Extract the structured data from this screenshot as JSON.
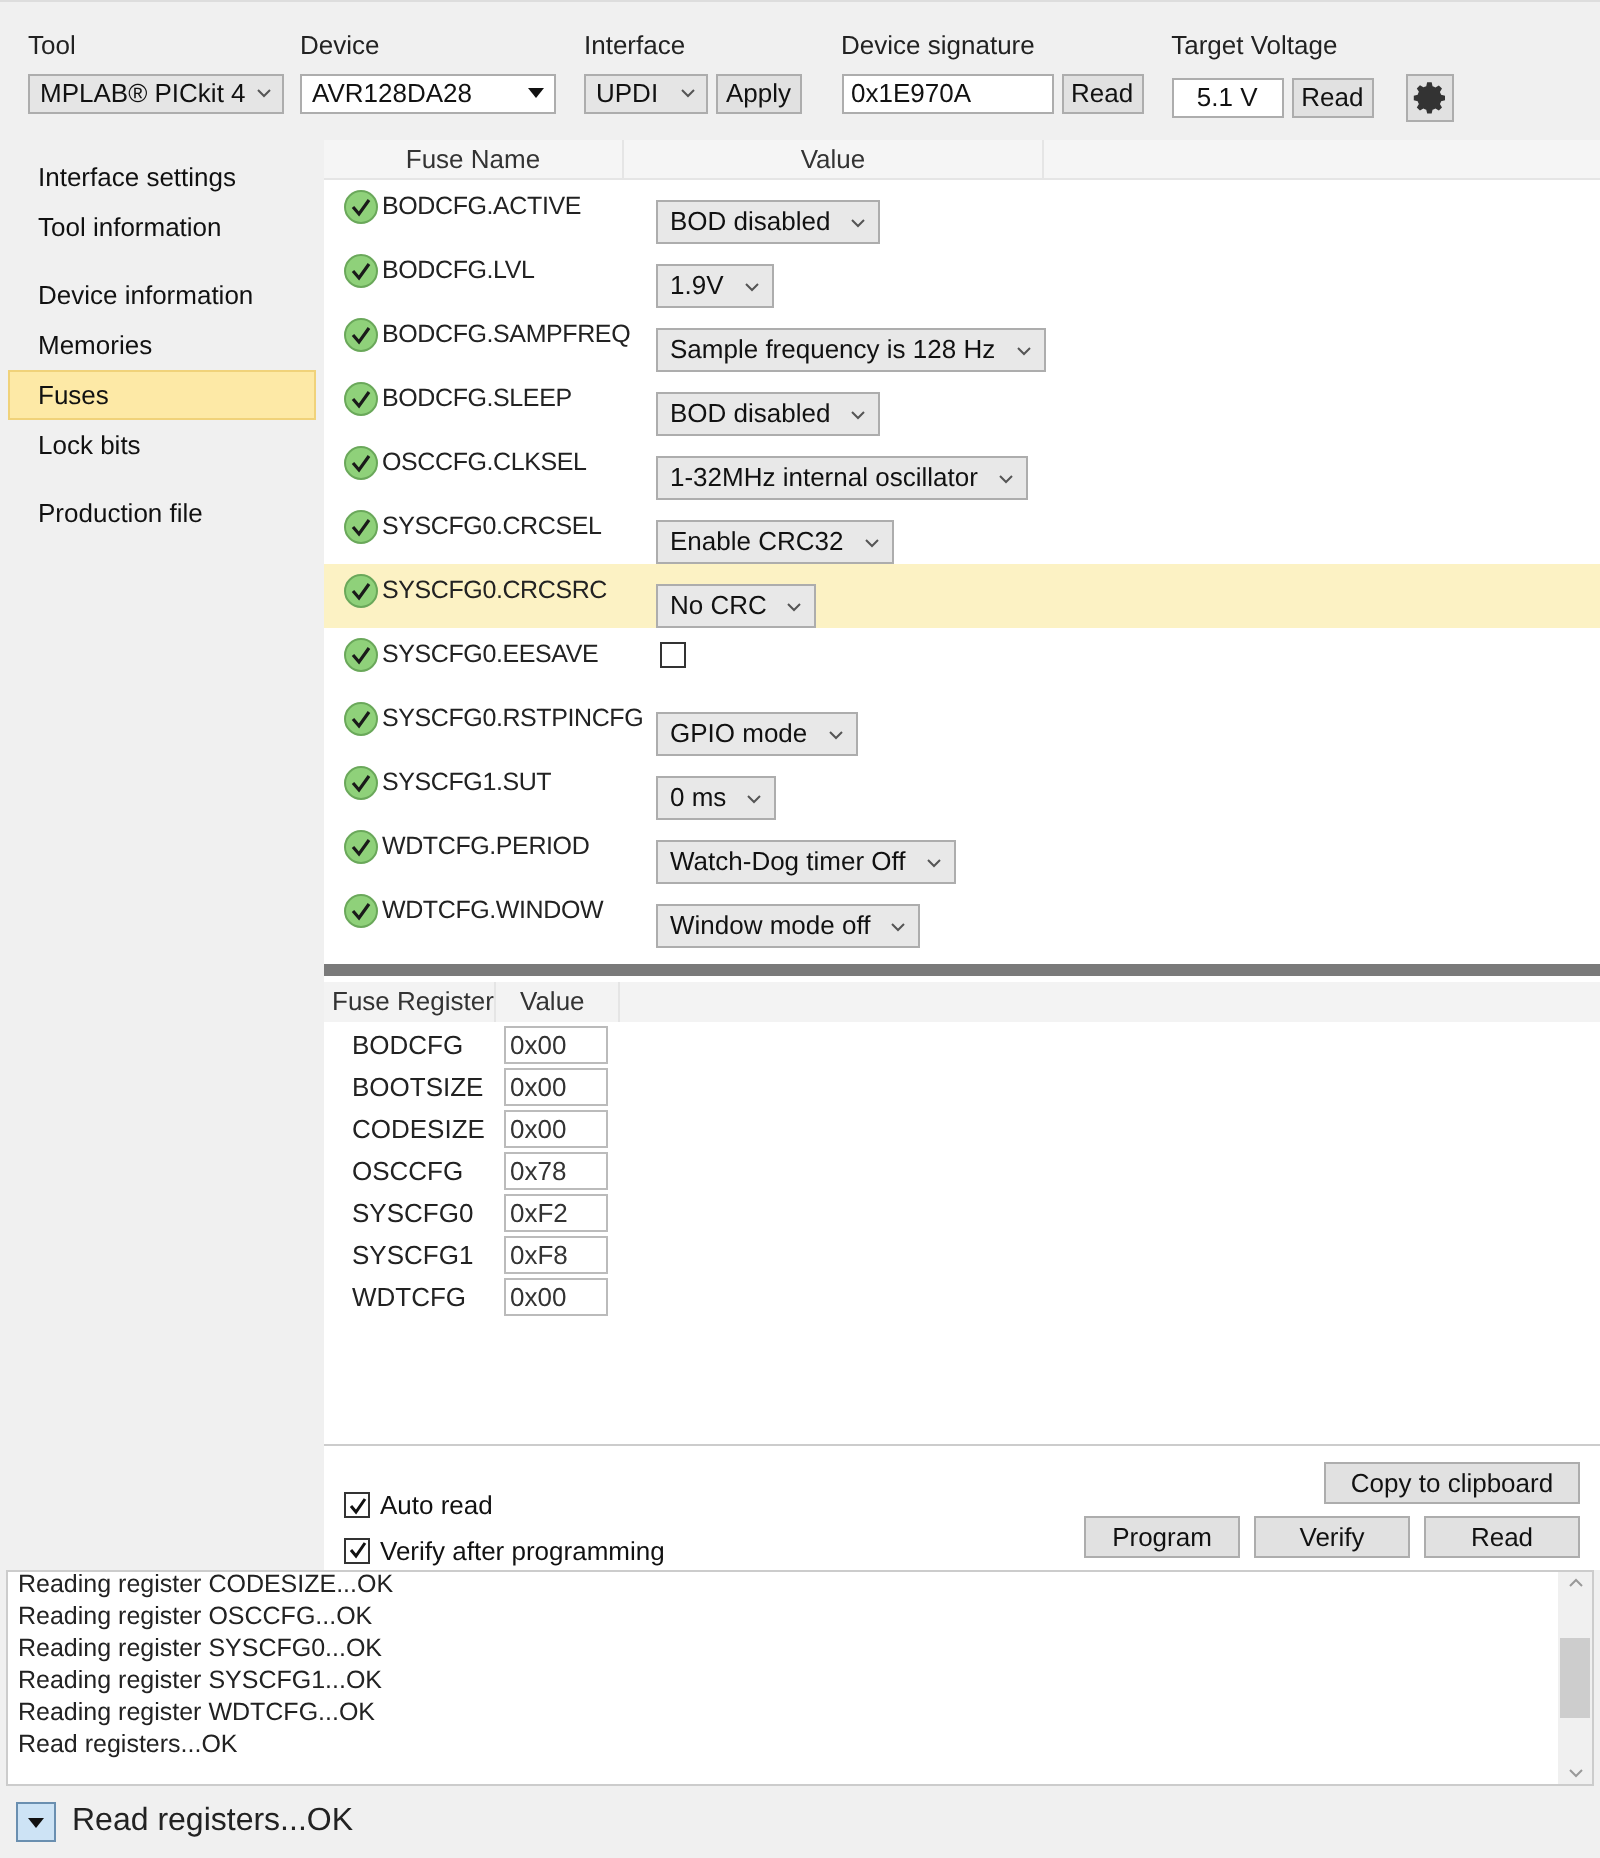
{
  "toolbar": {
    "tool": {
      "label": "Tool",
      "value": "MPLAB® PICkit 4"
    },
    "device": {
      "label": "Device",
      "value": "AVR128DA28"
    },
    "interface": {
      "label": "Interface",
      "value": "UPDI",
      "button": "Apply"
    },
    "signature": {
      "label": "Device signature",
      "value": "0x1E970A",
      "button": "Read"
    },
    "voltage": {
      "label": "Target Voltage",
      "value": "5.1 V",
      "button": "Read"
    }
  },
  "sidebar": {
    "groups": [
      {
        "items": [
          {
            "label": "Interface settings",
            "selected": false
          },
          {
            "label": "Tool information",
            "selected": false
          }
        ]
      },
      {
        "items": [
          {
            "label": "Device information",
            "selected": false
          },
          {
            "label": "Memories",
            "selected": false
          },
          {
            "label": "Fuses",
            "selected": true
          },
          {
            "label": "Lock bits",
            "selected": false
          }
        ]
      },
      {
        "items": [
          {
            "label": "Production file",
            "selected": false
          }
        ]
      }
    ]
  },
  "fuses": {
    "columns": [
      "Fuse Name",
      "Value"
    ],
    "rows": [
      {
        "name": "BODCFG.ACTIVE",
        "kind": "select",
        "value": "BOD disabled",
        "selected": false
      },
      {
        "name": "BODCFG.LVL",
        "kind": "select",
        "value": "1.9V",
        "selected": false
      },
      {
        "name": "BODCFG.SAMPFREQ",
        "kind": "select",
        "value": "Sample frequency is 128 Hz",
        "selected": false
      },
      {
        "name": "BODCFG.SLEEP",
        "kind": "select",
        "value": "BOD disabled",
        "selected": false
      },
      {
        "name": "OSCCFG.CLKSEL",
        "kind": "select",
        "value": "1-32MHz internal oscillator",
        "selected": false
      },
      {
        "name": "SYSCFG0.CRCSEL",
        "kind": "select",
        "value": "Enable CRC32",
        "selected": false
      },
      {
        "name": "SYSCFG0.CRCSRC",
        "kind": "select",
        "value": "No CRC",
        "selected": true
      },
      {
        "name": "SYSCFG0.EESAVE",
        "kind": "checkbox",
        "checked": false,
        "selected": false
      },
      {
        "name": "SYSCFG0.RSTPINCFG",
        "kind": "select",
        "value": "GPIO mode",
        "selected": false
      },
      {
        "name": "SYSCFG1.SUT",
        "kind": "select",
        "value": "0 ms",
        "selected": false
      },
      {
        "name": "WDTCFG.PERIOD",
        "kind": "select",
        "value": "Watch-Dog timer Off",
        "selected": false
      },
      {
        "name": "WDTCFG.WINDOW",
        "kind": "select",
        "value": "Window mode off",
        "selected": false
      }
    ]
  },
  "registers": {
    "columns": [
      "Fuse Register",
      "Value"
    ],
    "rows": [
      {
        "name": "BODCFG",
        "value": "0x00"
      },
      {
        "name": "BOOTSIZE",
        "value": "0x00"
      },
      {
        "name": "CODESIZE",
        "value": "0x00"
      },
      {
        "name": "OSCCFG",
        "value": "0x78"
      },
      {
        "name": "SYSCFG0",
        "value": "0xF2"
      },
      {
        "name": "SYSCFG1",
        "value": "0xF8"
      },
      {
        "name": "WDTCFG",
        "value": "0x00"
      }
    ]
  },
  "options": [
    {
      "label": "Auto read",
      "checked": true
    },
    {
      "label": "Verify after programming",
      "checked": true
    }
  ],
  "copy_button": "Copy to clipboard",
  "action_buttons": [
    "Program",
    "Verify",
    "Read"
  ],
  "log": [
    "Reading register CODESIZE...OK",
    "Reading register OSCCFG...OK",
    "Reading register SYSCFG0...OK",
    "Reading register SYSCFG1...OK",
    "Reading register WDTCFG...OK",
    "Read registers...OK"
  ],
  "status_bar": {
    "text": "Read registers...OK",
    "expanded": false
  }
}
